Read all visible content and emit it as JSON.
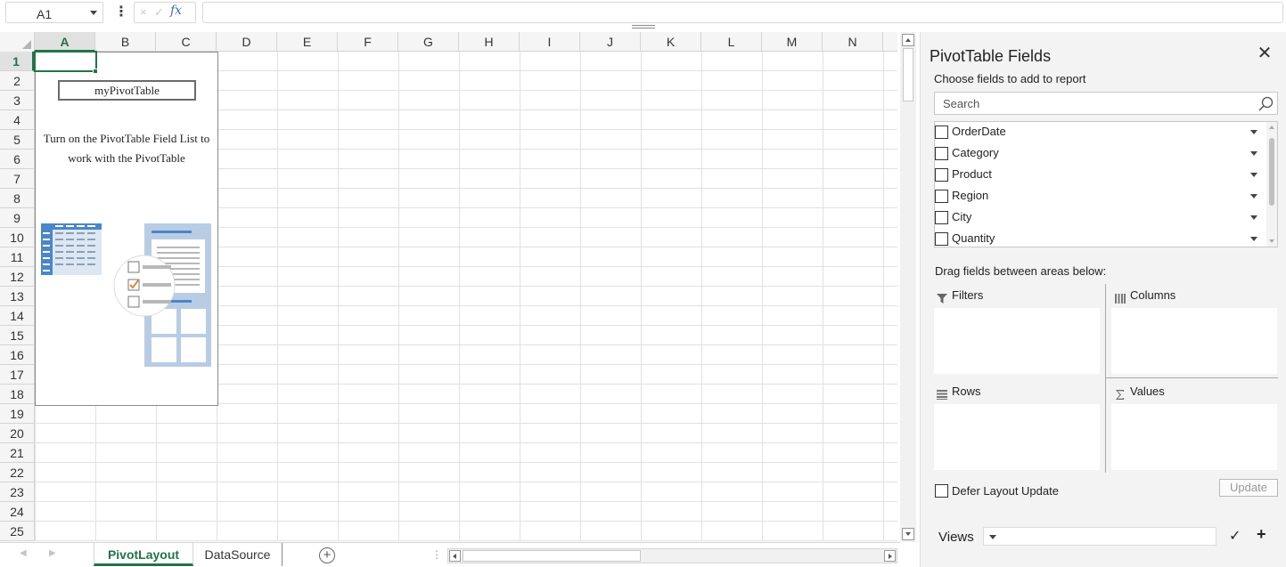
{
  "formula_bar": {
    "name_box": "A1",
    "more_icon": "⋮",
    "fx_label": "fx",
    "cancel_icon": "×",
    "enter_icon": "✓",
    "formula_value": ""
  },
  "sheet": {
    "columns": [
      "A",
      "B",
      "C",
      "D",
      "E",
      "F",
      "G",
      "H",
      "I",
      "J",
      "K",
      "L",
      "M",
      "N"
    ],
    "rows": [
      "1",
      "2",
      "3",
      "4",
      "5",
      "6",
      "7",
      "8",
      "9",
      "10",
      "11",
      "12",
      "13",
      "14",
      "15",
      "16",
      "17",
      "18",
      "19",
      "20",
      "21",
      "22",
      "23",
      "24",
      "25"
    ],
    "selected_column": "A",
    "selected_row": "1"
  },
  "pivot_placeholder": {
    "name": "myPivotTable",
    "hint": "Turn on the PivotTable Field List to work with the PivotTable"
  },
  "tabs": {
    "items": [
      "PivotLayout",
      "DataSource"
    ],
    "active": "PivotLayout",
    "add_icon": "+"
  },
  "field_panel": {
    "title": "PivotTable Fields",
    "close_icon": "✕",
    "choose_label": "Choose fields to add to report",
    "search_placeholder": "Search",
    "fields": [
      {
        "label": "OrderDate",
        "checked": false
      },
      {
        "label": "Category",
        "checked": false
      },
      {
        "label": "Product",
        "checked": false
      },
      {
        "label": "Region",
        "checked": false
      },
      {
        "label": "City",
        "checked": false
      },
      {
        "label": "Quantity",
        "checked": false
      }
    ],
    "drag_label": "Drag fields between areas below:",
    "areas": {
      "filters": "Filters",
      "columns": "Columns",
      "rows": "Rows",
      "values": "Values"
    },
    "defer_label": "Defer Layout Update",
    "defer_checked": false,
    "update_label": "Update",
    "views_label": "Views",
    "views_value": "",
    "views_accept_icon": "✓",
    "views_add_icon": "+"
  },
  "colors": {
    "accent": "#217346",
    "panel_bg": "#f3f3f3",
    "grid_line": "#e1e1e1",
    "illustration_blue": "#4a86c8"
  }
}
